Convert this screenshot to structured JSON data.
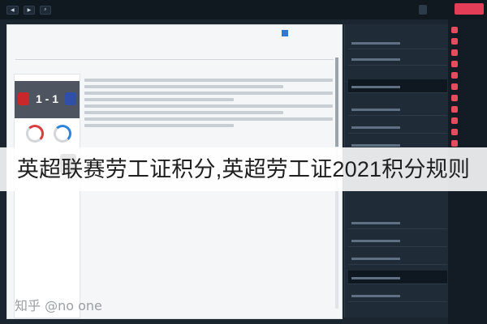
{
  "caption": "英超联赛劳工证积分,英超劳工证2021积分规则",
  "watermark": "知乎 @no one",
  "colors": {
    "accent": "#e43d57",
    "sidebar_bg": "#131c25",
    "document_bg": "#f4f6f8"
  },
  "match_score": "1 - 1"
}
